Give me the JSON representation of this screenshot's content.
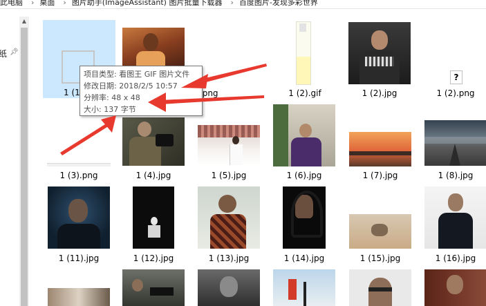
{
  "breadcrumb": [
    "此电脑",
    "桌面",
    "图片助手(ImageAssistant) 图片批量下载器",
    "百度图片-发现多彩世界"
  ],
  "breadcrumb_sep": "›",
  "nav": {
    "label": "纸"
  },
  "tooltip": {
    "type": "项目类型: 看图王 GIF 图片文件",
    "modified": "修改日期: 2018/2/5 10:57",
    "resolution": "分辨率: 48 x 48",
    "size": "大小: 137 字节"
  },
  "files": [
    {
      "name": "1 (1"
    },
    {
      "name": "1 (1).png"
    },
    {
      "name": "1 (2).gif"
    },
    {
      "name": "1 (2).jpg"
    },
    {
      "name": "1 (2).png"
    },
    {
      "name": "1 (3).png"
    },
    {
      "name": "1 (4).jpg"
    },
    {
      "name": "1 (5).jpg"
    },
    {
      "name": "1 (6).jpg"
    },
    {
      "name": "1 (7).jpg"
    },
    {
      "name": "1 (8).jpg"
    },
    {
      "name": "1 (11).jpg"
    },
    {
      "name": "1 (12).jpg"
    },
    {
      "name": "1 (13).jpg"
    },
    {
      "name": "1 (14).jpg"
    },
    {
      "name": "1 (15).jpg"
    },
    {
      "name": "1 (16).jpg"
    }
  ],
  "unknown_icon_glyph": "?",
  "colors": {
    "selection": "#cce8ff",
    "arrow": "#e8392f"
  }
}
